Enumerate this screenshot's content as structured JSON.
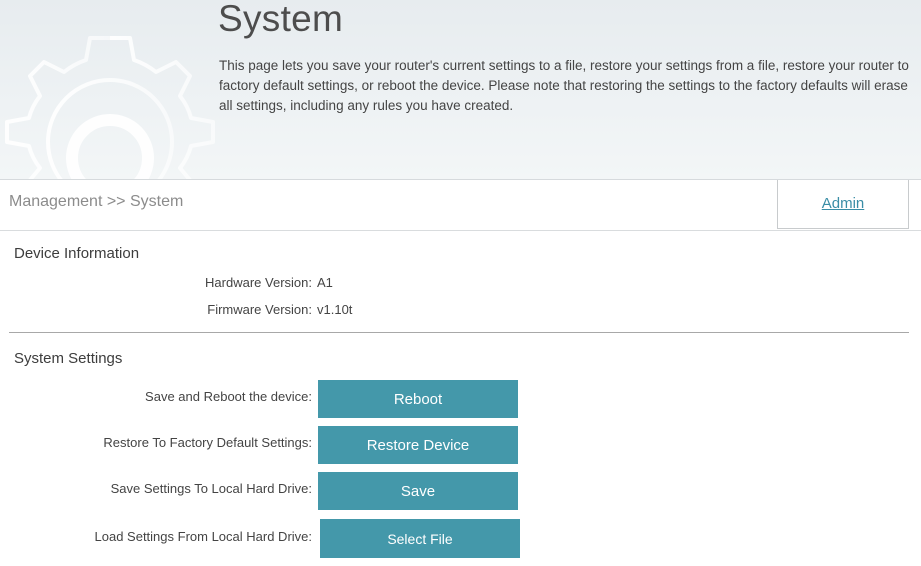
{
  "header": {
    "title": "System",
    "description": "This page lets you save your router's current settings to a file, restore your settings from a file, restore your router to factory default settings, or reboot the device. Please note that restoring the settings to the factory defaults will erase all settings, including any rules you have created."
  },
  "breadcrumb": "Management >> System",
  "admin_link": "Admin",
  "device_info": {
    "title": "Device Information",
    "hardware_label": "Hardware Version:",
    "hardware_value": "A1",
    "firmware_label": "Firmware Version:",
    "firmware_value": "v1.10t"
  },
  "system_settings": {
    "title": "System Settings",
    "reboot_label": "Save and Reboot the device:",
    "reboot_button": "Reboot",
    "restore_label": "Restore To Factory Default Settings:",
    "restore_button": "Restore Device",
    "save_label": "Save Settings To Local Hard Drive:",
    "save_button": "Save",
    "load_label": "Load Settings From Local Hard Drive:",
    "load_button": "Select File"
  },
  "colors": {
    "accent": "#4498aa",
    "link": "#3a8da6"
  },
  "icons": [
    "gear-icon"
  ]
}
